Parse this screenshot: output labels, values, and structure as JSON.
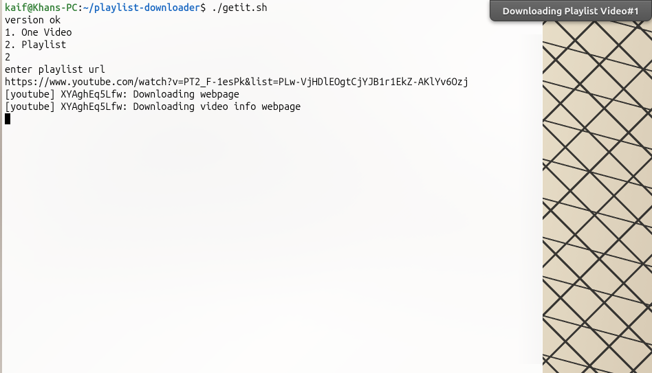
{
  "notification": {
    "text": "Downloading Playlist Video#1"
  },
  "terminal": {
    "prompt": {
      "user_host": "kaif@Khans-PC",
      "separator": ":",
      "path": "~/playlist-downloader",
      "dollar": "$ "
    },
    "command": "./getit.sh",
    "lines": [
      "version ok",
      "1. One Video",
      "2. Playlist",
      "2",
      "enter playlist url",
      "https://www.youtube.com/watch?v=PT2_F-1esPk&list=PLw-VjHDlEOgtCjYJB1r1EkZ-AKlYv6Ozj",
      "[youtube] XYAghEq5Lfw: Downloading webpage",
      "[youtube] XYAghEq5Lfw: Downloading video info webpage"
    ]
  }
}
